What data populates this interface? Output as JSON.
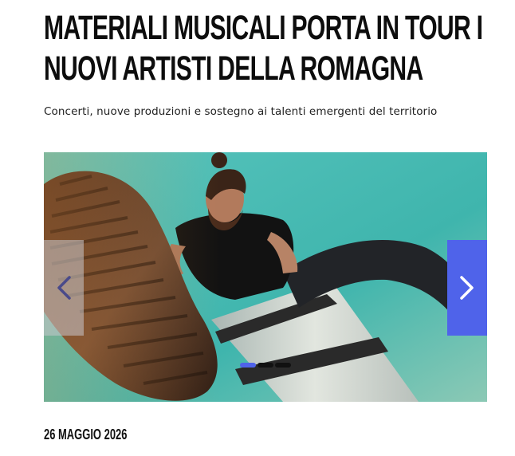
{
  "article": {
    "title": "MATERIALI MUSICALI PORTA IN TOUR I NUOVI ARTISTI DELLA ROMAGNA",
    "subtitle": "Concerti, nuove produzioni e sostegno ai talenti emergenti del territorio",
    "date": "26 MAGGIO 2026"
  },
  "carousel": {
    "image_alt": "Musicista seduto su un palo visto dal basso con la suola di una scarpa in primo piano",
    "slide_count": 3,
    "active_slide": 1,
    "prev_icon": "chevron-left-icon",
    "next_icon": "chevron-right-icon"
  },
  "colors": {
    "accent": "#4f63ea",
    "sky": "#3fb7b0",
    "text": "#111111"
  }
}
